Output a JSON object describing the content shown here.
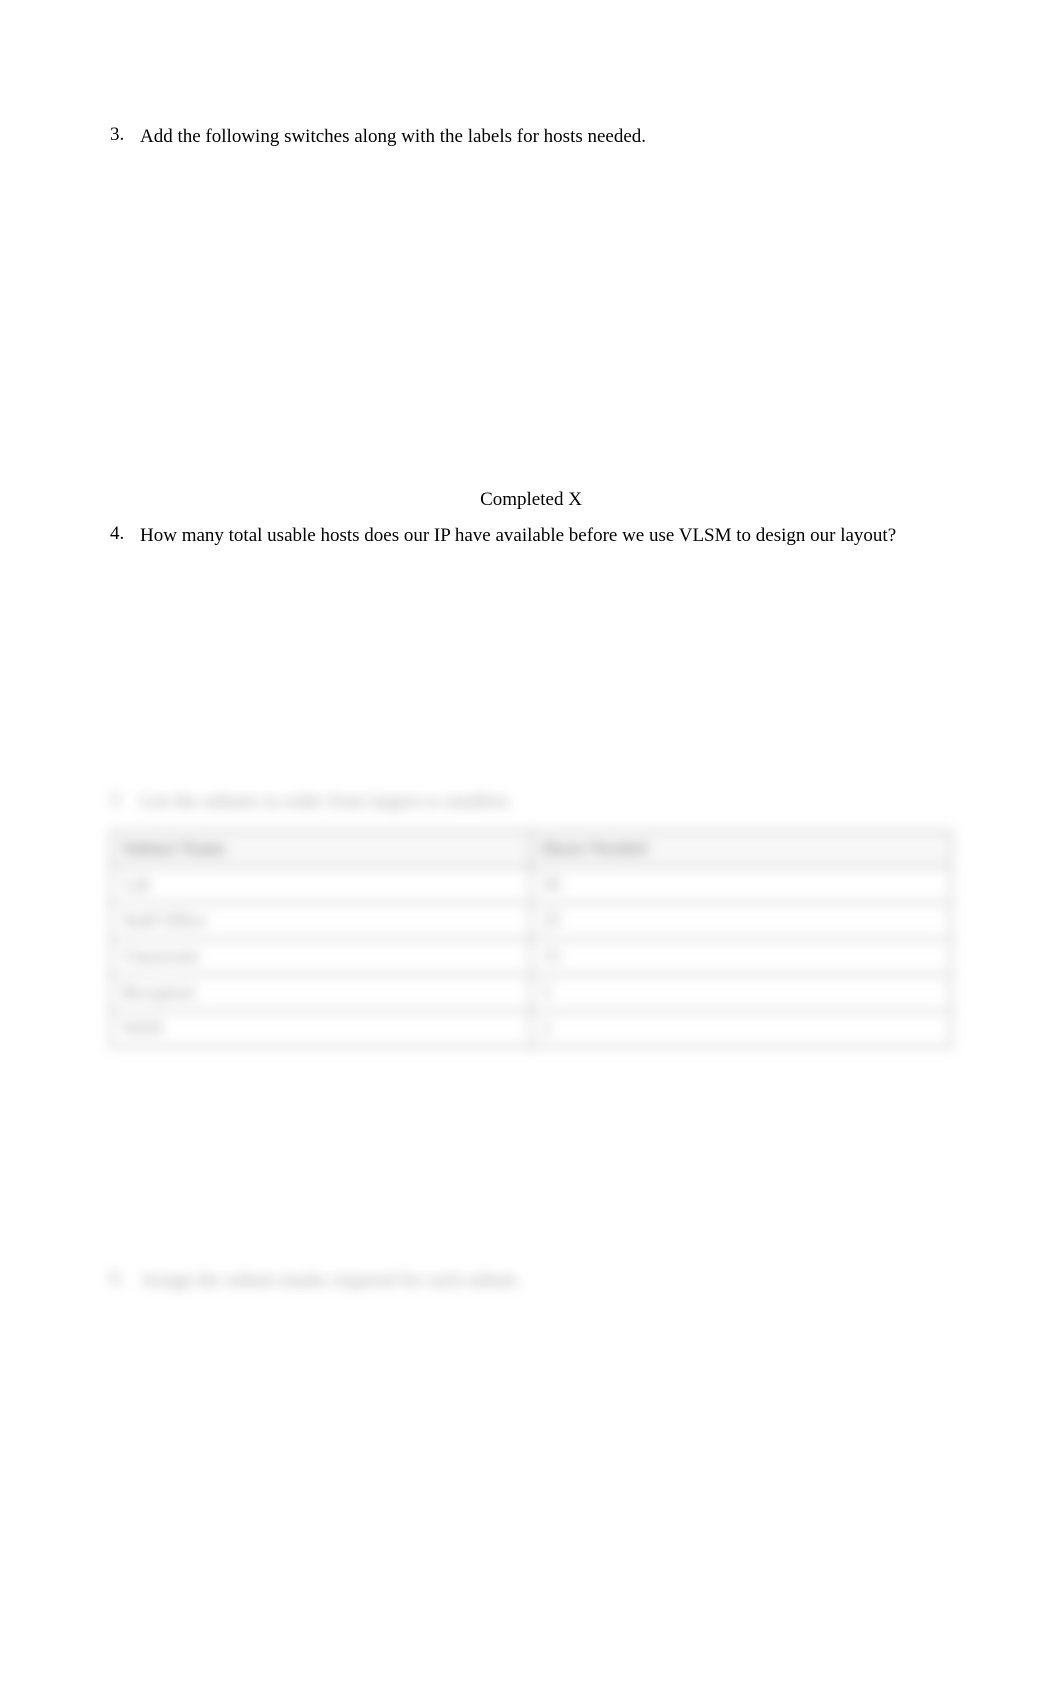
{
  "item3": {
    "number": "3.",
    "text": "Add the following switches along with the labels for hosts needed."
  },
  "completed": "Completed X",
  "item4": {
    "number": "4.",
    "text": "How many total usable hosts does our IP have available before we use VLSM to design our layout?"
  },
  "answer_blur": "",
  "item5": {
    "number": "5.",
    "text": "List the subnets in order from largest to smallest."
  },
  "table": {
    "headers": [
      "Subnet Name",
      "Hosts Needed"
    ],
    "rows": [
      [
        "Lab",
        "50"
      ],
      [
        "Staff Office",
        "25"
      ],
      [
        "Classroom",
        "15"
      ],
      [
        "Reception",
        "5"
      ],
      [
        "WAN",
        "2"
      ]
    ]
  },
  "item6": {
    "number": "6.",
    "text": "Assign the subnet masks required for each subnet."
  }
}
